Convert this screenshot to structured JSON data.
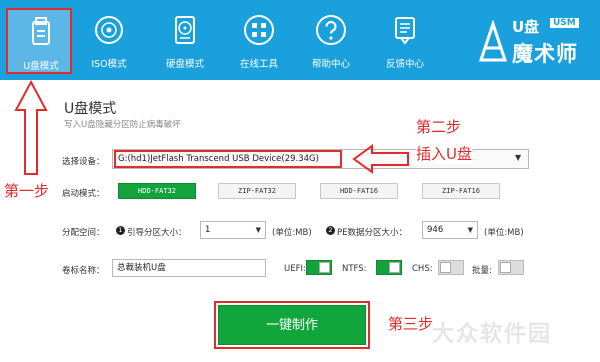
{
  "toolbar": {
    "items": [
      {
        "label": "U盘模式",
        "icon": "usb-drive-icon",
        "active": true
      },
      {
        "label": "ISO模式",
        "icon": "disc-icon",
        "active": false
      },
      {
        "label": "硬盘模式",
        "icon": "hard-disk-icon",
        "active": false
      },
      {
        "label": "在线工具",
        "icon": "grid-tools-icon",
        "active": false
      },
      {
        "label": "帮助中心",
        "icon": "help-icon",
        "active": false
      },
      {
        "label": "反馈中心",
        "icon": "feedback-icon",
        "active": false
      }
    ],
    "brand": {
      "usb_text": "U盘",
      "usb_tag": "USM",
      "name": "魔术师"
    }
  },
  "panel": {
    "title": "U盘模式",
    "subtitle": "写入U盘隐藏分区防止病毒破坏",
    "device": {
      "label": "选择设备：",
      "value": "G:(hd1)JetFlash Transcend USB Device(29.34G)"
    },
    "boot_mode": {
      "label": "启动模式：",
      "options": [
        "HDD-FAT32",
        "ZIP-FAT32",
        "HDD-FAT16",
        "ZIP-FAT16"
      ],
      "selected": "HDD-FAT32"
    },
    "partition": {
      "label": "分配空间：",
      "boot_badge": "1",
      "boot_label": "引导分区大小：",
      "boot_value": "1",
      "boot_unit": "(单位:MB)",
      "pe_badge": "2",
      "pe_label": "PE数据分区大小：",
      "pe_value": "946",
      "pe_unit": "(单位:MB)"
    },
    "volume": {
      "label": "卷标名称：",
      "value": "总裁装机U盘"
    },
    "toggles": [
      {
        "label": "UEFI:",
        "on": true
      },
      {
        "label": "NTFS:",
        "on": true
      },
      {
        "label": "CHS:",
        "on": false
      },
      {
        "label": "批量:",
        "on": false
      }
    ],
    "make_button": "一键制作"
  },
  "annotations": {
    "step1": "第一步",
    "step2_line1": "第二步",
    "step2_line2": "插入U盘",
    "step3": "第三步"
  },
  "watermark": "大众软件园",
  "colors": {
    "toolbar": "#1aa0dc",
    "accent_green": "#14a23c",
    "annotation_red": "#e32b2b"
  }
}
